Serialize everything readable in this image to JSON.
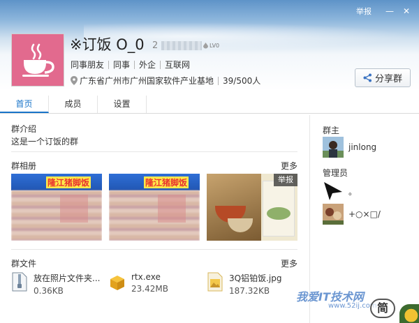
{
  "window": {
    "report_link": "举报",
    "minimize": "—",
    "close": "✕"
  },
  "group": {
    "name": "※订饭 O_0",
    "id_prefix": "2",
    "level": "LV0",
    "tags": [
      "同事朋友",
      "同事",
      "外企",
      "互联网"
    ],
    "location": "广东省广州市广州国家软件产业基地",
    "members": "39/500人",
    "share_button": "分享群",
    "avatar_color": "#e26a8e"
  },
  "tabs": [
    {
      "label": "首页",
      "active": true
    },
    {
      "label": "成员",
      "active": false
    },
    {
      "label": "设置",
      "active": false
    }
  ],
  "intro": {
    "title": "群介绍",
    "text": "这是一个订饭的群"
  },
  "album": {
    "title": "群相册",
    "more": "更多",
    "photos": [
      {
        "banner": "隆江猪脚饭"
      },
      {
        "banner": "隆江猪脚饭"
      },
      {
        "badge": "举报"
      }
    ]
  },
  "files": {
    "title": "群文件",
    "more": "更多",
    "items": [
      {
        "name": "放在照片文件夹...",
        "size": "0.36KB",
        "icon": "zip-file-icon"
      },
      {
        "name": "rtx.exe",
        "size": "23.42MB",
        "icon": "exe-file-icon"
      },
      {
        "name": "3Q铝铂饭.jpg",
        "size": "187.32KB",
        "icon": "image-file-icon"
      }
    ]
  },
  "sidebar": {
    "owner_title": "群主",
    "owner": {
      "name": "jinlong"
    },
    "admin_title": "管理员",
    "admins": [
      {
        "name": "。"
      },
      {
        "name": "+○×□/"
      }
    ]
  },
  "watermark": {
    "text": "我爱IT技术网",
    "url": "www.52ij.com"
  },
  "corner_button": "简",
  "colors": {
    "accent": "#1874c9",
    "header_top": "#5e93c8",
    "brand_pink": "#e26a8e"
  }
}
